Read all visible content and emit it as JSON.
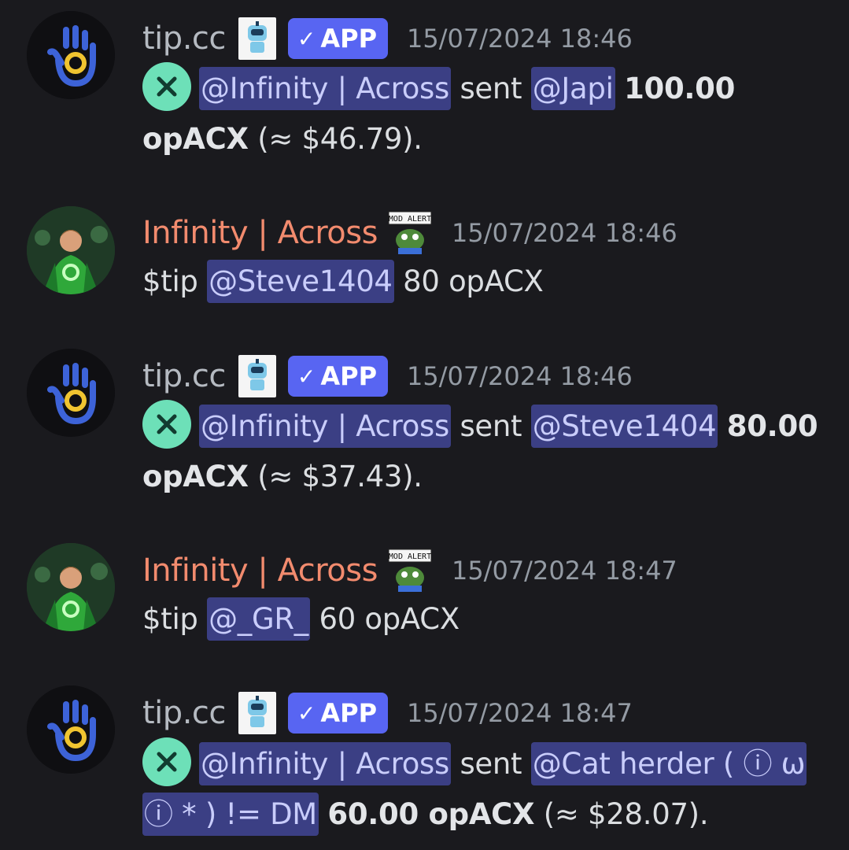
{
  "messages": [
    {
      "type": "bot",
      "author": "tip.cc",
      "app_label": "APP",
      "timestamp": "15/07/2024 18:46",
      "sender_mention": "@Infinity | Across",
      "verb": "sent",
      "recipient_mention": "@Japi",
      "amount": "100.00",
      "currency": "opACX",
      "value": "(≈ $46.79)."
    },
    {
      "type": "user",
      "author": "Infinity | Across",
      "timestamp": "15/07/2024 18:46",
      "command": "$tip",
      "mention": "@Steve1404",
      "rest": "80 opACX"
    },
    {
      "type": "bot",
      "author": "tip.cc",
      "app_label": "APP",
      "timestamp": "15/07/2024 18:46",
      "sender_mention": "@Infinity | Across",
      "verb": "sent",
      "recipient_mention": "@Steve1404",
      "amount": "80.00",
      "currency": "opACX",
      "value": "(≈ $37.43)."
    },
    {
      "type": "user",
      "author": "Infinity | Across",
      "timestamp": "15/07/2024 18:47",
      "command": "$tip",
      "mention": "@_GR_",
      "rest": "60 opACX"
    },
    {
      "type": "bot",
      "author": "tip.cc",
      "app_label": "APP",
      "timestamp": "15/07/2024 18:47",
      "sender_mention": "@Infinity | Across",
      "verb": "sent",
      "recipient_mention_a": "@Cat herder ( ⓘ ω",
      "recipient_mention_b": "ⓘ * ) != DM",
      "amount_currency": "60.00 opACX",
      "value": "(≈ $28.07)."
    }
  ],
  "icons": {
    "bot_avatar": "hand-logo-icon",
    "bot_badge": "robot-emoji-icon",
    "user_badge": "mod-alert-pepe-icon",
    "tx_icon": "x-circle-icon"
  },
  "mod_alert_text": "MOD ALERT",
  "colors": {
    "background": "#1a1a1e",
    "bot_name": "#b5bac1",
    "user_name": "#f28b6e",
    "app_tag": "#5865f2",
    "mention_bg": "#3b3f84",
    "tx_icon": "#6de0b8"
  }
}
